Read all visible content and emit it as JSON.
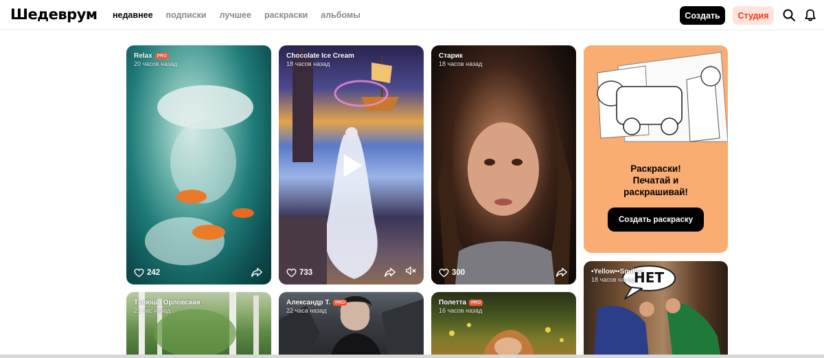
{
  "header": {
    "logo": "Шедеврум",
    "nav": [
      {
        "label": "недавнее",
        "active": true
      },
      {
        "label": "подписки",
        "active": false
      },
      {
        "label": "лучшее",
        "active": false
      },
      {
        "label": "раскраски",
        "active": false
      },
      {
        "label": "альбомы",
        "active": false
      }
    ],
    "create_button": "Создать",
    "studio_button": "Студия",
    "icons": [
      "search-icon",
      "bell-icon"
    ]
  },
  "feed": {
    "cards": [
      {
        "author": "Relax",
        "pro_badge": "PRO",
        "time": "20 часов назад",
        "likes": "242",
        "theme": "teal"
      },
      {
        "author": "Chocolate Ice Cream",
        "time": "18 часов назад",
        "likes": "733",
        "is_video": true,
        "theme": "fantasy"
      },
      {
        "author": "Старик",
        "time": "18 часов назад",
        "likes": "300",
        "theme": "portrait"
      },
      {
        "author": "Танюша Орловская",
        "time": "21 час назад",
        "theme": "forest"
      },
      {
        "author": "Александр Т.",
        "pro_badge": "PRO",
        "time": "22 часа назад",
        "theme": "dark"
      },
      {
        "author": "Полетта",
        "pro_badge": "PRO",
        "time": "16 часов назад",
        "theme": "meadow"
      },
      {
        "author": "•Yellow••Smiley•",
        "time": "18 часов назад",
        "speech_bubble": "НЕТ",
        "theme": "comic"
      }
    ],
    "promo": {
      "title_lines": [
        "Раскраски!",
        "Печатай и",
        "раскрашивай!"
      ],
      "button": "Создать раскраску"
    }
  },
  "colors": {
    "accent": "#ef3a1e",
    "studio_bg": "#fde3dc",
    "promo_bg": "#f9ad73",
    "pro_badge": "#ff5a36"
  }
}
